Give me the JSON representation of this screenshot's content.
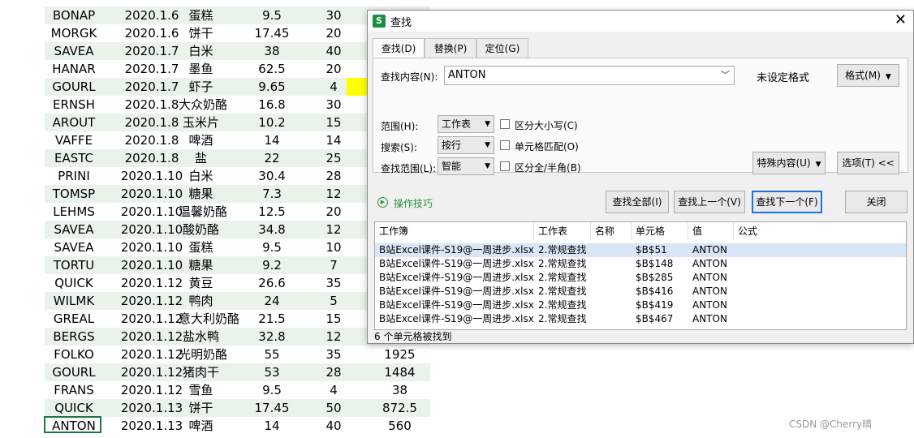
{
  "sheet": {
    "rows": [
      [
        "BONAP",
        "2020.1.6",
        "蛋糕",
        "9.5",
        "30",
        ""
      ],
      [
        "MORGK",
        "2020.1.6",
        "饼干",
        "17.45",
        "20",
        ""
      ],
      [
        "SAVEA",
        "2020.1.7",
        "白米",
        "38",
        "40",
        ""
      ],
      [
        "HANAR",
        "2020.1.7",
        "墨鱼",
        "62.5",
        "20",
        ""
      ],
      [
        "GOURL",
        "2020.1.7",
        "虾子",
        "9.65",
        "4",
        ""
      ],
      [
        "ERNSH",
        "2020.1.8",
        "大众奶酪",
        "16.8",
        "30",
        ""
      ],
      [
        "AROUT",
        "2020.1.8",
        "玉米片",
        "10.2",
        "15",
        ""
      ],
      [
        "VAFFE",
        "2020.1.8",
        "啤酒",
        "14",
        "14",
        ""
      ],
      [
        "EASTC",
        "2020.1.8",
        "盐",
        "22",
        "25",
        ""
      ],
      [
        "PRINI",
        "2020.1.10",
        "白米",
        "30.4",
        "28",
        ""
      ],
      [
        "TOMSP",
        "2020.1.10",
        "糖果",
        "7.3",
        "12",
        ""
      ],
      [
        "LEHMS",
        "2020.1.10",
        "温馨奶酪",
        "12.5",
        "20",
        ""
      ],
      [
        "SAVEA",
        "2020.1.10",
        "酸奶酪",
        "34.8",
        "12",
        ""
      ],
      [
        "SAVEA",
        "2020.1.10",
        "蛋糕",
        "9.5",
        "10",
        ""
      ],
      [
        "TORTU",
        "2020.1.10",
        "糖果",
        "9.2",
        "7",
        ""
      ],
      [
        "QUICK",
        "2020.1.12",
        "黄豆",
        "26.6",
        "35",
        ""
      ],
      [
        "WILMK",
        "2020.1.12",
        "鸭肉",
        "24",
        "5",
        ""
      ],
      [
        "GREAL",
        "2020.1.12",
        "意大利奶酪",
        "21.5",
        "15",
        ""
      ],
      [
        "BERGS",
        "2020.1.12",
        "盐水鸭",
        "32.8",
        "12",
        ""
      ],
      [
        "FOLKO",
        "2020.1.12",
        "光明奶酪",
        "55",
        "35",
        "1925"
      ],
      [
        "GOURL",
        "2020.1.12",
        "猪肉干",
        "53",
        "28",
        "1484"
      ],
      [
        "FRANS",
        "2020.1.12",
        "雪鱼",
        "9.5",
        "4",
        "38"
      ],
      [
        "QUICK",
        "2020.1.13",
        "饼干",
        "17.45",
        "50",
        "872.5"
      ],
      [
        "ANTON",
        "2020.1.13",
        "啤酒",
        "14",
        "40",
        "560"
      ]
    ],
    "highlight_color": "#ffff00",
    "active_cell_color": "#227447"
  },
  "dialog": {
    "title": "查找",
    "app_icon": "S",
    "close_glyph": "✕",
    "tabs": [
      "查找(D)",
      "替换(P)",
      "定位(G)"
    ],
    "find_label": "查找内容(N):",
    "find_value": "ANTON",
    "format_status": "未设定格式",
    "format_button": "格式(M)",
    "scope_label": "范围(H):",
    "scope_value": "工作表",
    "search_label": "搜索(S):",
    "search_value": "按行",
    "lookin_label": "查找范围(L):",
    "lookin_value": "智能",
    "match_case": "区分大小写(C)",
    "match_cell": "单元格匹配(O)",
    "match_width": "区分全/半角(B)",
    "special_button": "特殊内容(U)",
    "options_button": "选项(T) <<",
    "tips_link": "操作技巧",
    "find_all": "查找全部(I)",
    "find_prev": "查找上一个(V)",
    "find_next": "查找下一个(F)",
    "close_button": "关闭",
    "results_headers": [
      "工作簿",
      "工作表",
      "名称",
      "单元格",
      "值",
      "公式"
    ],
    "results": [
      {
        "book": "B站Excel课件-S19@一周进步.xlsx",
        "sheet": "2.常规查找",
        "name": "",
        "cell": "$B$51",
        "value": "ANTON",
        "formula": ""
      },
      {
        "book": "B站Excel课件-S19@一周进步.xlsx",
        "sheet": "2.常规查找",
        "name": "",
        "cell": "$B$148",
        "value": "ANTON",
        "formula": ""
      },
      {
        "book": "B站Excel课件-S19@一周进步.xlsx",
        "sheet": "2.常规查找",
        "name": "",
        "cell": "$B$285",
        "value": "ANTON",
        "formula": ""
      },
      {
        "book": "B站Excel课件-S19@一周进步.xlsx",
        "sheet": "2.常规查找",
        "name": "",
        "cell": "$B$416",
        "value": "ANTON",
        "formula": ""
      },
      {
        "book": "B站Excel课件-S19@一周进步.xlsx",
        "sheet": "2.常规查找",
        "name": "",
        "cell": "$B$419",
        "value": "ANTON",
        "formula": ""
      },
      {
        "book": "B站Excel课件-S19@一周进步.xlsx",
        "sheet": "2.常规查找",
        "name": "",
        "cell": "$B$467",
        "value": "ANTON",
        "formula": ""
      }
    ],
    "status": "6 个单元格被找到"
  },
  "watermark": "CSDN @Cherry晴"
}
